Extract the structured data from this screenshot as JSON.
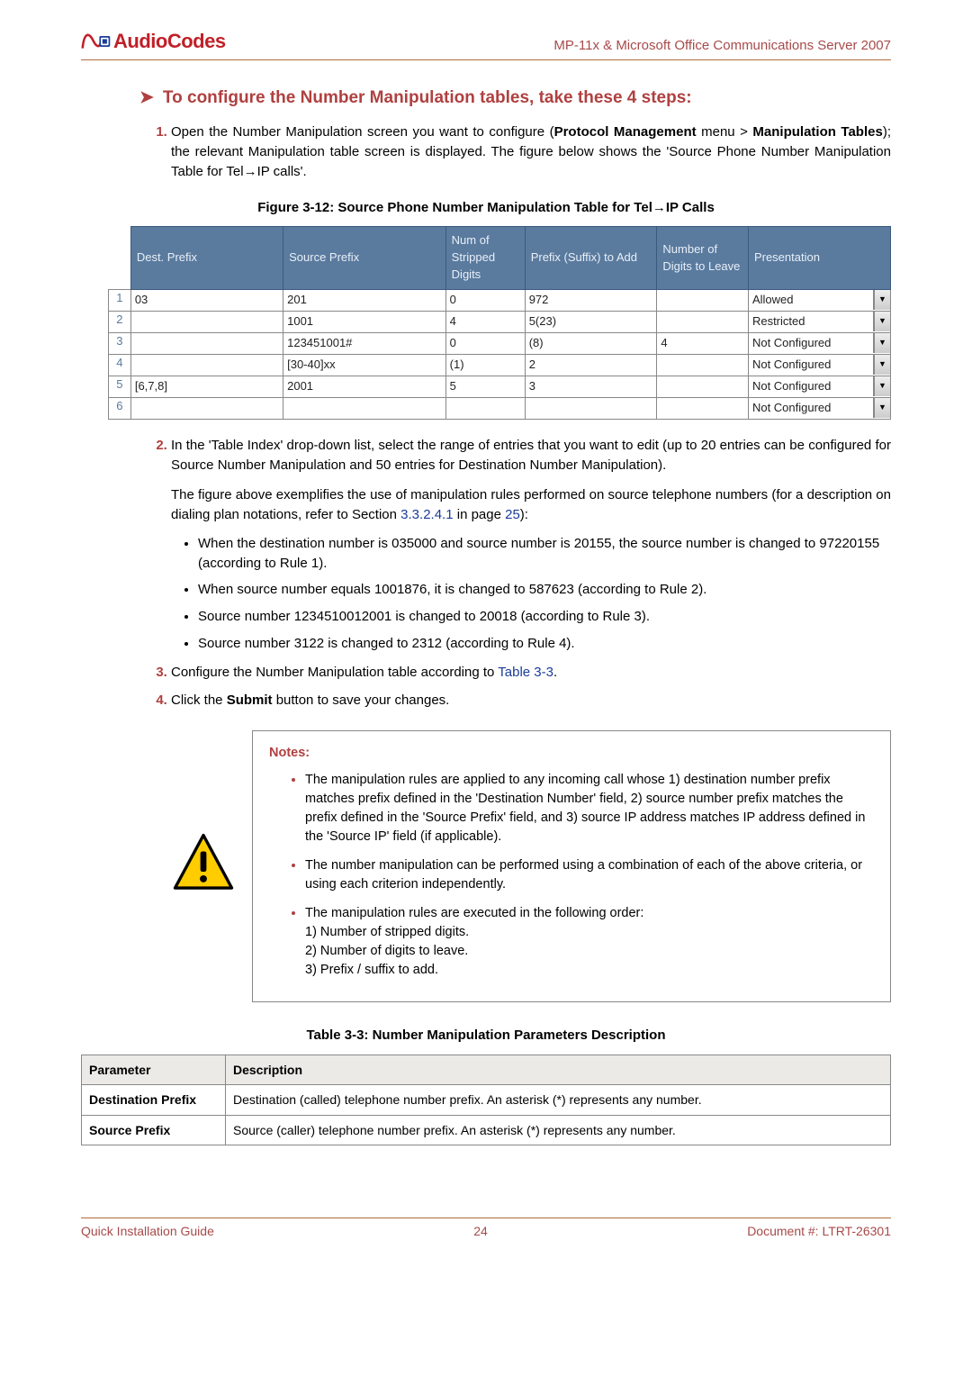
{
  "header": {
    "logo_text": "AudioCodes",
    "right_text": "MP-11x & Microsoft Office Communications Server 2007"
  },
  "heading": "To configure the Number Manipulation tables, take these 4 steps:",
  "step1_parts": [
    "Open the Number Manipulation screen you want to configure (",
    "Protocol Management",
    " menu > ",
    "Manipulation Tables",
    "); the relevant Manipulation table screen is displayed. The figure below shows the 'Source Phone Number Manipulation Table for Tel→IP calls'."
  ],
  "figure_caption": "Figure 3-12: Source Phone Number Manipulation Table for Tel→IP Calls",
  "manip_headers": [
    "Dest. Prefix",
    "Source Prefix",
    "Num of Stripped Digits",
    "Prefix (Suffix) to Add",
    "Number of Digits to Leave",
    "Presentation"
  ],
  "manip_rows": [
    {
      "idx": "1",
      "dest": "03",
      "src": "201",
      "strip": "0",
      "add": "972",
      "leave": "",
      "pres": "Allowed"
    },
    {
      "idx": "2",
      "dest": "",
      "src": "1001",
      "strip": "4",
      "add": "5(23)",
      "leave": "",
      "pres": "Restricted"
    },
    {
      "idx": "3",
      "dest": "",
      "src": "123451001#",
      "strip": "0",
      "add": "(8)",
      "leave": "4",
      "pres": "Not Configured"
    },
    {
      "idx": "4",
      "dest": "",
      "src": "[30-40]xx",
      "strip": "(1)",
      "add": "2",
      "leave": "",
      "pres": "Not Configured"
    },
    {
      "idx": "5",
      "dest": "[6,7,8]",
      "src": "2001",
      "strip": "5",
      "add": "3",
      "leave": "",
      "pres": "Not Configured"
    },
    {
      "idx": "6",
      "dest": "",
      "src": "",
      "strip": "",
      "add": "",
      "leave": "",
      "pres": "Not Configured"
    }
  ],
  "step2": "In the 'Table Index' drop-down list, select the range of entries that you want to edit (up to 20 entries can be configured for Source Number Manipulation and 50 entries for Destination Number Manipulation).",
  "body_para": {
    "pre": "The figure above exemplifies the use of manipulation rules performed on source telephone numbers (for a description on dialing plan notations, refer to Section ",
    "link1": "3.3.2.4.1",
    "mid": " in page ",
    "link2": "25",
    "post": "):"
  },
  "sub_bullets": [
    "When the destination number is 035000 and source number is 20155, the source number is changed to 97220155 (according to Rule 1).",
    "When source number equals 1001876, it is changed to 587623 (according to Rule 2).",
    "Source number 1234510012001 is changed to 20018 (according to Rule 3).",
    "Source number 3122 is changed to 2312 (according to Rule 4)."
  ],
  "step3": {
    "pre": "Configure the Number Manipulation table according to ",
    "link": "Table 3-3",
    "post": "."
  },
  "step4": {
    "pre": "Click the ",
    "bold": "Submit",
    "post": " button to save your changes."
  },
  "notes_heading": "Notes:",
  "notes_bullets": [
    "The manipulation rules are applied to any incoming call whose 1) destination number prefix matches prefix defined in the 'Destination Number' field, 2) source number prefix matches the prefix defined in the 'Source Prefix' field, and 3) source IP address matches IP address defined in the 'Source IP' field (if applicable).",
    "The number manipulation can be performed using a combination of each of the above criteria, or using each criterion independently.",
    "The manipulation rules are executed in the following order:\n1) Number of stripped digits.\n2) Number of digits to leave.\n3) Prefix / suffix to add."
  ],
  "table3_caption": "Table 3-3: Number Manipulation Parameters Description",
  "params_headers": [
    "Parameter",
    "Description"
  ],
  "params_rows": [
    {
      "p": "Destination Prefix",
      "d": "Destination (called) telephone number prefix. An asterisk (*) represents any number."
    },
    {
      "p": "Source Prefix",
      "d": "Source (caller) telephone number prefix. An asterisk (*) represents any number."
    }
  ],
  "footer": {
    "left": "Quick Installation Guide",
    "center": "24",
    "right": "Document #: LTRT-26301"
  }
}
